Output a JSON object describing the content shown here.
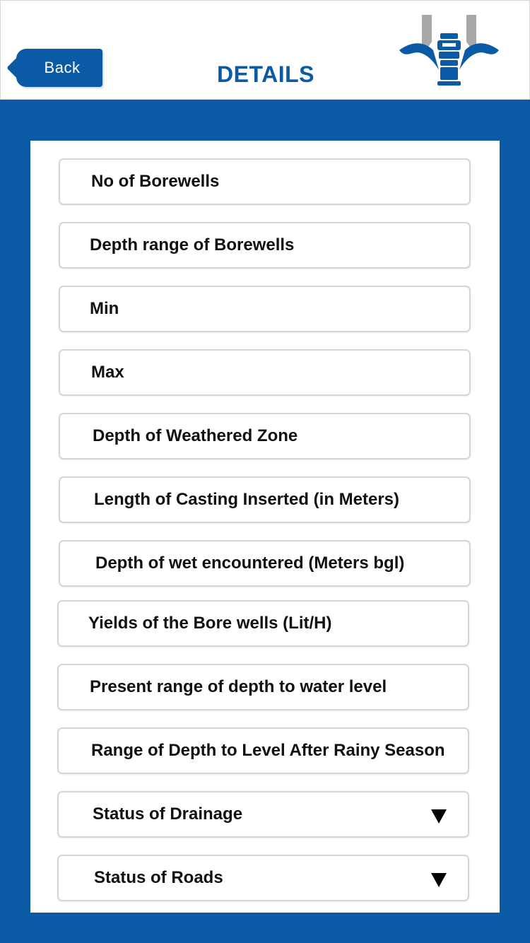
{
  "header": {
    "back_label": "Back",
    "title": "DETAILS",
    "logo_icon": "hydrant-logo-icon"
  },
  "colors": {
    "primary": "#0b5aa5",
    "logo_gray": "#a8a8a8"
  },
  "fields": [
    {
      "label": "No of Borewells",
      "type": "text"
    },
    {
      "label": "Depth range of Borewells",
      "type": "text"
    },
    {
      "label": "Min",
      "type": "text"
    },
    {
      "label": "Max",
      "type": "text"
    },
    {
      "label": "Depth of Weathered Zone",
      "type": "text"
    },
    {
      "label": "Length of Casting Inserted (in Meters)",
      "type": "text"
    },
    {
      "label": "Depth of wet encountered (Meters bgl)",
      "type": "text"
    },
    {
      "label": "Yields of the Bore wells (Lit/H)",
      "type": "text"
    },
    {
      "label": "Present range of depth to water level",
      "type": "text"
    },
    {
      "label": "Range of Depth to Level After Rainy Season",
      "type": "text"
    },
    {
      "label": "Status of Drainage",
      "type": "dropdown",
      "icon": "dropdown-arrow-icon"
    },
    {
      "label": "Status of Roads",
      "type": "dropdown",
      "icon": "dropdown-arrow-icon"
    }
  ]
}
